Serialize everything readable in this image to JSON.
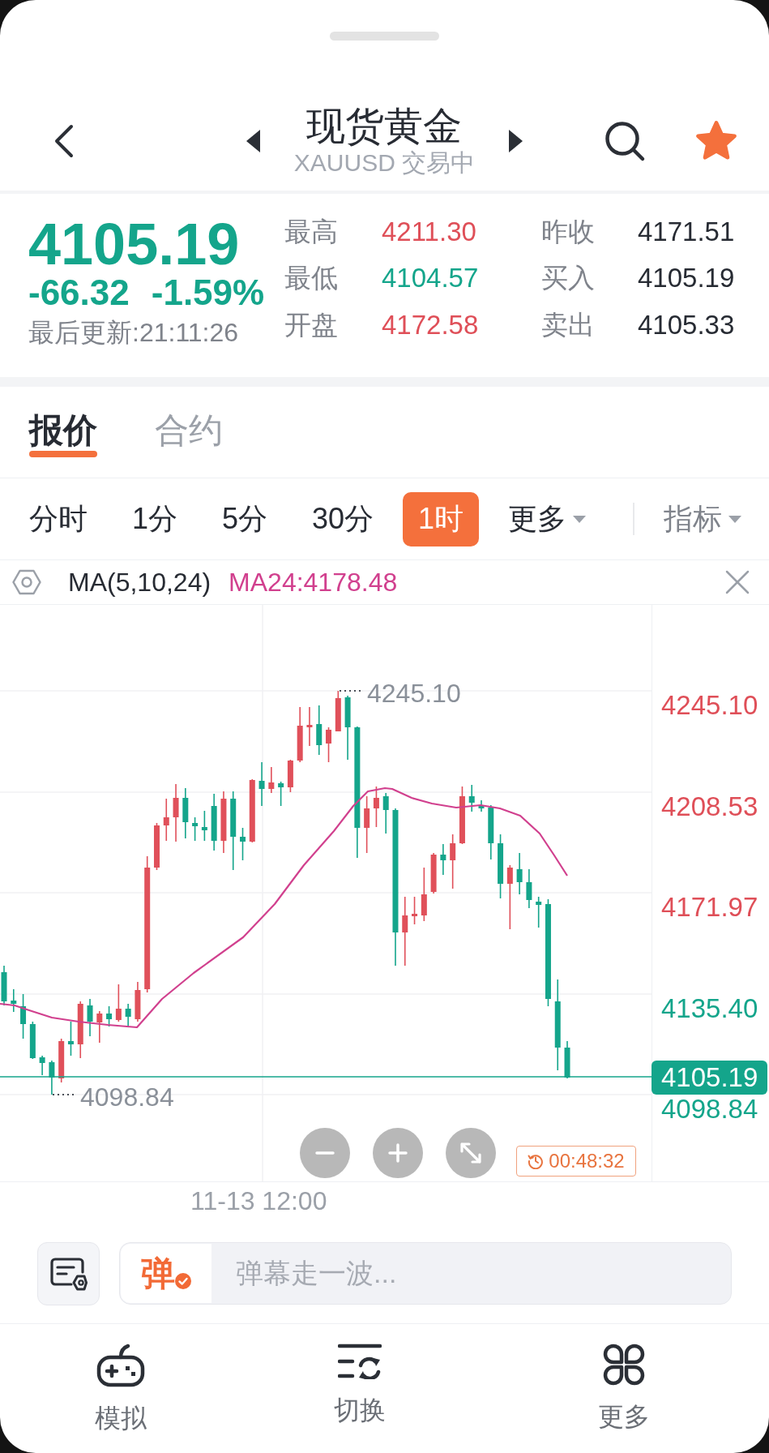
{
  "header": {
    "title": "现货黄金",
    "subtitle": "XAUUSD 交易中",
    "favorite": true
  },
  "quote": {
    "price": "4105.19",
    "rising": false,
    "change": "-66.32",
    "change_percent": "-1.59%",
    "updated": "最后更新:21:11:26",
    "stats": [
      {
        "label": "最高",
        "value": "4211.30",
        "color": "#df4f58"
      },
      {
        "label": "昨收",
        "value": "4171.51",
        "color": "#272b33"
      },
      {
        "label": "最低",
        "value": "4104.57",
        "color": "#14a58b"
      },
      {
        "label": "买入",
        "value": "4105.19",
        "color": "#272b33"
      },
      {
        "label": "开盘",
        "value": "4172.58",
        "color": "#df4f58"
      },
      {
        "label": "卖出",
        "value": "4105.33",
        "color": "#272b33"
      }
    ]
  },
  "tabs": [
    {
      "label": "报价",
      "selected": true
    },
    {
      "label": "合约",
      "selected": false
    }
  ],
  "periods": [
    {
      "label": "分时",
      "kind": "period",
      "selected": false
    },
    {
      "label": "1分",
      "kind": "period",
      "selected": false
    },
    {
      "label": "5分",
      "kind": "period",
      "selected": false
    },
    {
      "label": "30分",
      "kind": "period",
      "selected": false
    },
    {
      "label": "1时",
      "kind": "period",
      "selected": true
    },
    {
      "label": "更多",
      "kind": "menu",
      "selected": false
    }
  ],
  "indicator_menu": {
    "label": "指标"
  },
  "indicator_bar": {
    "name": "MA(5,10,24)",
    "value": "MA24:4178.48"
  },
  "chart": {
    "axis_labels": [
      {
        "label": "4245.10",
        "color": "#df4f58"
      },
      {
        "label": "4208.53",
        "color": "#df4f58"
      },
      {
        "label": "4171.97",
        "color": "#df4f58"
      },
      {
        "label": "4135.40",
        "color": "#14a58b"
      },
      {
        "label": "4098.84",
        "color": "#14a58b"
      }
    ],
    "high_label": "4245.10",
    "low_label": "4098.84",
    "last_price": "4105.19",
    "time_label": "11-13 12:00",
    "countdown": "00:48:32"
  },
  "comment_bar": {
    "logo": "弹",
    "placeholder": "弹幕走一波..."
  },
  "bottom_nav": [
    {
      "label": "模拟",
      "kind": "gamepad"
    },
    {
      "label": "切换",
      "kind": "switch"
    },
    {
      "label": "更多",
      "kind": "grid"
    }
  ]
}
